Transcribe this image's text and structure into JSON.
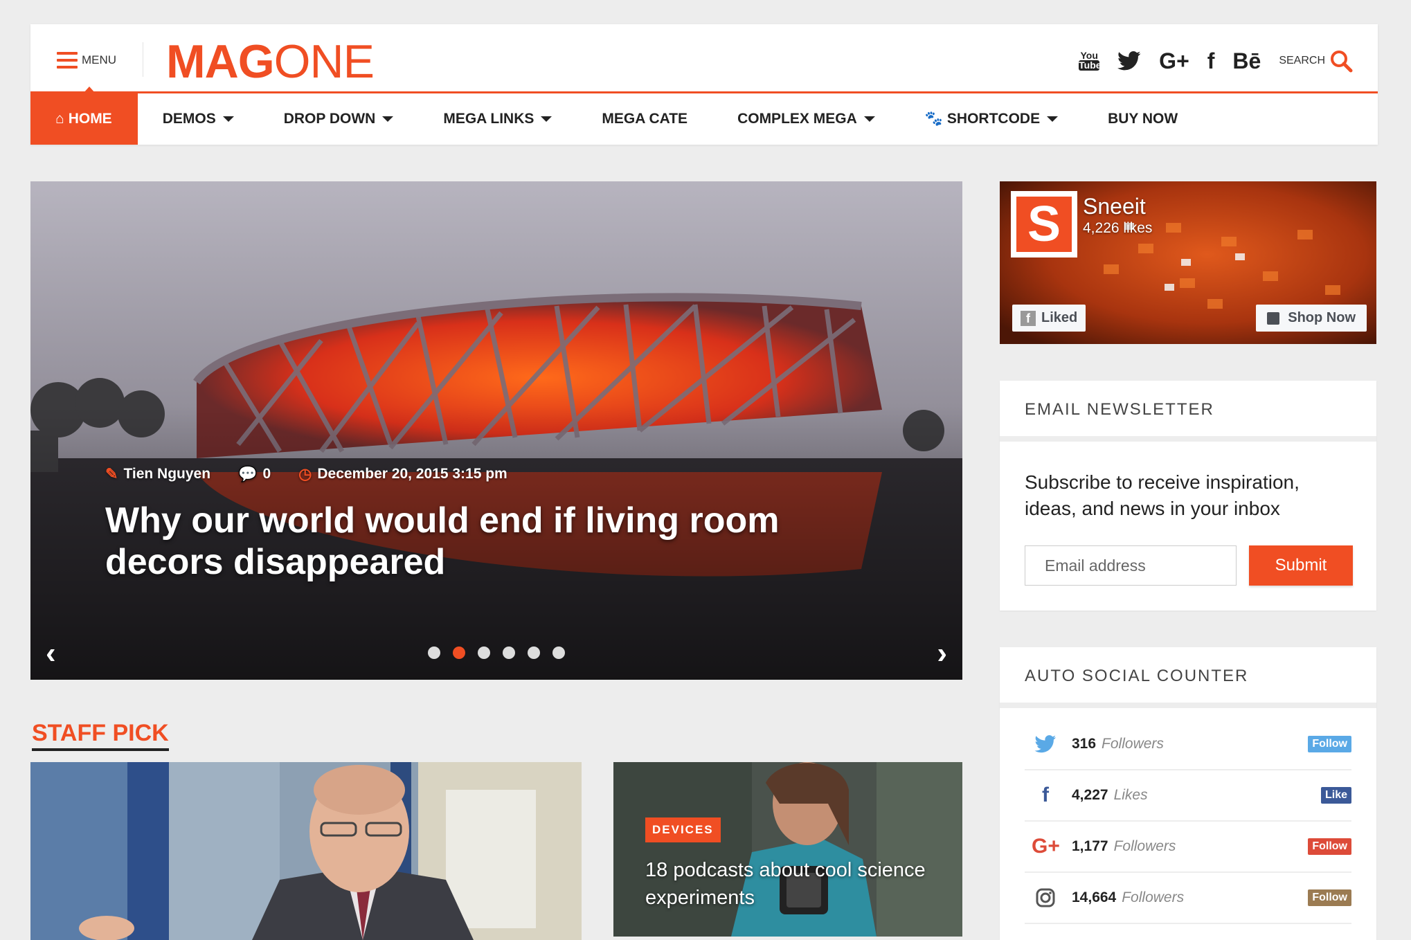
{
  "header": {
    "menu_label": "MENU",
    "logo_bold": "MAG",
    "logo_thin": "ONE",
    "social_icons": [
      "youtube-icon",
      "twitter-icon",
      "google-plus-icon",
      "facebook-icon",
      "behance-icon"
    ],
    "youtube_top": "You",
    "youtube_bottom": "Tube",
    "google_plus": "G+",
    "facebook": "f",
    "behance": "Bē",
    "search_label": "SEARCH",
    "accent_color": "#f04e23"
  },
  "nav": {
    "items": [
      {
        "label": "HOME",
        "icon": "home-icon",
        "active": true
      },
      {
        "label": "DEMOS",
        "dropdown": true
      },
      {
        "label": "DROP DOWN",
        "dropdown": true
      },
      {
        "label": "MEGA LINKS",
        "dropdown": true
      },
      {
        "label": "MEGA CATE",
        "dropdown": false
      },
      {
        "label": "COMPLEX MEGA",
        "dropdown": true
      },
      {
        "label": "SHORTCODE",
        "icon": "paw-icon",
        "dropdown": true
      },
      {
        "label": "BUY NOW",
        "dropdown": false
      }
    ]
  },
  "hero": {
    "author": "Tien Nguyen",
    "comments": "0",
    "date": "December 20, 2015 3:15 pm",
    "title": "Why our world would end if living room decors disappeared",
    "slides": 6,
    "active_slide": 2,
    "prev": "‹",
    "next": "›"
  },
  "staff_pick": {
    "title": "STAFF PICK",
    "card2": {
      "category": "DEVICES",
      "title": "18 podcasts about cool science experiments"
    }
  },
  "sidebar": {
    "facebook": {
      "logo_letter": "S",
      "name": "Sneeit",
      "likes": "4,226 likes",
      "liked_label": "Liked",
      "shop_label": "Shop Now"
    },
    "newsletter": {
      "title": "EMAIL NEWSLETTER",
      "text": "Subscribe to receive inspiration, ideas, and news in your inbox",
      "email_placeholder": "Email address",
      "submit_label": "Submit"
    },
    "social_counter": {
      "title": "AUTO SOCIAL COUNTER",
      "rows": [
        {
          "icon": "twitter-icon",
          "count": "316",
          "unit": "Followers",
          "button": "Follow",
          "color": "#5aa9e6"
        },
        {
          "icon": "facebook-icon",
          "count": "4,227",
          "unit": "Likes",
          "button": "Like",
          "color": "#3b5998"
        },
        {
          "icon": "google-plus-icon",
          "count": "1,177",
          "unit": "Followers",
          "button": "Follow",
          "color": "#dd4b39"
        },
        {
          "icon": "instagram-icon",
          "count": "14,664",
          "unit": "Followers",
          "button": "Follow",
          "color": "#9b7b52"
        }
      ]
    }
  }
}
